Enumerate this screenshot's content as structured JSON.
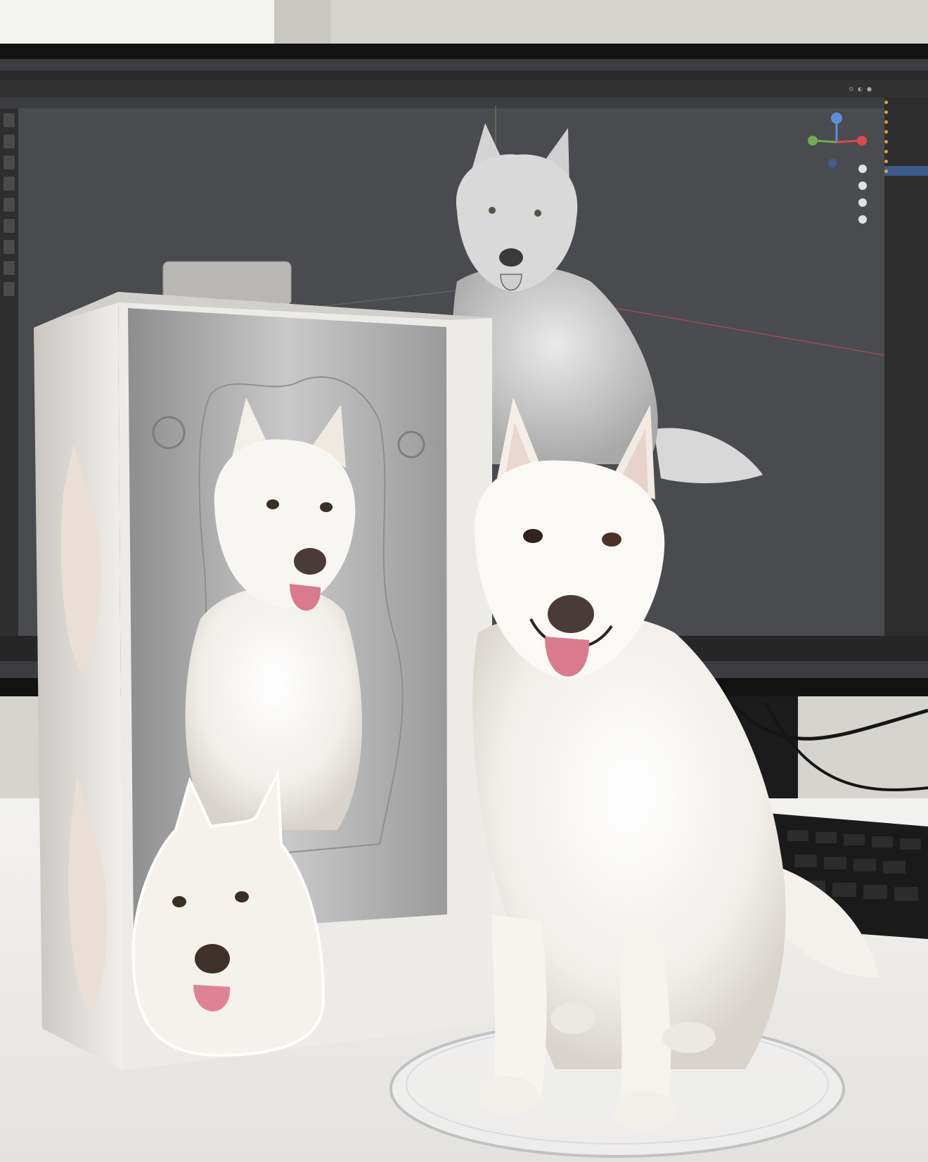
{
  "screen": {
    "app_title": "",
    "menu": [
      "",
      "",
      "",
      "",
      "",
      "",
      "",
      "",
      ""
    ],
    "toolbar": [
      "",
      "",
      "",
      "",
      "",
      "",
      ""
    ],
    "viewport_header": [
      "",
      ""
    ],
    "viewport_label": "",
    "outliner_items": [
      "",
      "",
      "",
      "",
      "",
      "",
      "",
      ""
    ],
    "properties_items": [
      "",
      "",
      "",
      "",
      "",
      "",
      "",
      ""
    ]
  },
  "scene_description_colors": {
    "wall": "#d9d7d2",
    "viewport_bg": "#4a4b4e",
    "monitor_bezel": "#121212",
    "desk": "#efeeec",
    "dog_white": "#f6f4f1",
    "tongue": "#d97b8c",
    "nose": "#4a3a38"
  }
}
